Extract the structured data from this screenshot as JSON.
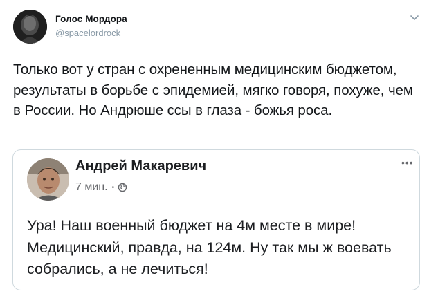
{
  "tweet": {
    "author_name": "Голос Мордора",
    "author_handle": "@spacelordrock",
    "text": "Только вот у стран с охрененным медицинским бюджетом, результаты в борьбе с эпидемией, мягко говоря, похуже, чем в России. Но Андрюше ссы в глаза - божья роса.",
    "menu_icon": "chevron-down-icon"
  },
  "quoted_post": {
    "author_name": "Андрей Макаревич",
    "time": "7 мин.",
    "separator": "•",
    "privacy_icon": "globe-icon",
    "more_icon": "more-dots-icon",
    "more_label": "•••",
    "text": "Ура! Наш военный бюджет на 4м месте в мире! Медицинский, правда, на 124м. Ну так мы ж воевать собрались, а не лечиться!"
  },
  "colors": {
    "text_primary": "#14171a",
    "text_secondary": "#8899a6",
    "card_border": "#cfd9de",
    "fb_text": "#1c1e21",
    "fb_secondary": "#65676b"
  }
}
